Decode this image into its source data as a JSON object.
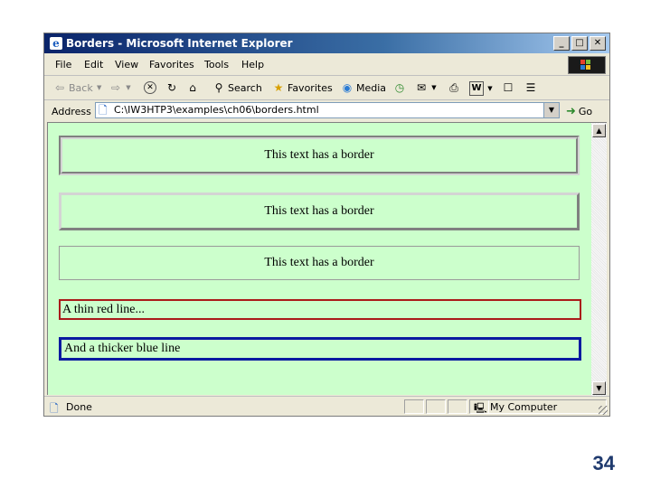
{
  "window": {
    "title": "Borders - Microsoft Internet Explorer",
    "controls": {
      "minimize": "_",
      "maximize": "□",
      "close": "✕"
    }
  },
  "menu": [
    "File",
    "Edit",
    "View",
    "Favorites",
    "Tools",
    "Help"
  ],
  "toolbar": {
    "back": "Back",
    "search": "Search",
    "favorites": "Favorites",
    "media": "Media"
  },
  "address": {
    "label": "Address",
    "value": "C:\\IW3HTP3\\examples\\ch06\\borders.html",
    "go": "Go"
  },
  "content": {
    "boxes": [
      {
        "text": "This text has a border",
        "style": "groove"
      },
      {
        "text": "This text has a border",
        "style": "inset"
      },
      {
        "text": "This text has a border",
        "style": "outset"
      },
      {
        "text": "A thin red line...",
        "style": "thin red solid"
      },
      {
        "text": "And a thicker blue line",
        "style": "thick blue solid"
      }
    ],
    "background": "#ccffcc"
  },
  "status": {
    "text": "Done",
    "zone": "My Computer"
  },
  "slide": {
    "page_number": "34"
  }
}
